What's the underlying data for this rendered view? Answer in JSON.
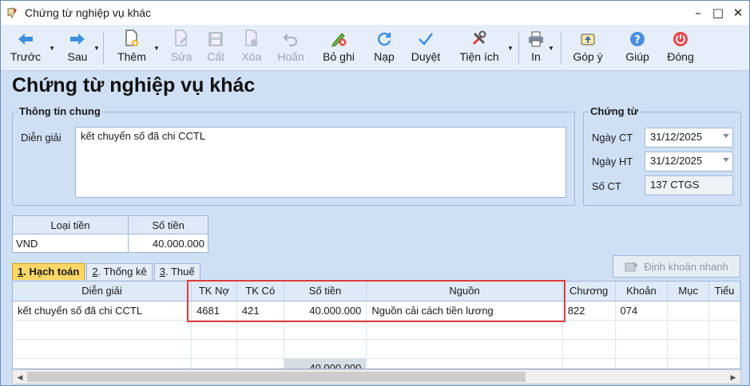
{
  "window": {
    "title": "Chứng từ nghiệp vụ khác",
    "minimize": "–",
    "maximize": "□",
    "close": "✕"
  },
  "toolbar": {
    "items": [
      {
        "label": "Trước",
        "icon": "arrow-left-icon"
      },
      {
        "label": "Sau",
        "icon": "arrow-right-icon"
      },
      {
        "label": "Thêm",
        "icon": "add-document-icon"
      },
      {
        "label": "Sửa",
        "icon": "edit-document-icon"
      },
      {
        "label": "Cất",
        "icon": "save-icon"
      },
      {
        "label": "Xóa",
        "icon": "delete-document-icon"
      },
      {
        "label": "Hoãn",
        "icon": "undo-icon"
      },
      {
        "label": "Bỏ ghi",
        "icon": "unpost-icon"
      },
      {
        "label": "Nạp",
        "icon": "refresh-icon"
      },
      {
        "label": "Duyệt",
        "icon": "checkmark-icon"
      },
      {
        "label": "Tiện ích",
        "icon": "tools-icon"
      },
      {
        "label": "In",
        "icon": "printer-icon"
      },
      {
        "label": "Góp ý",
        "icon": "feedback-icon"
      },
      {
        "label": "Giúp",
        "icon": "help-icon"
      },
      {
        "label": "Đóng",
        "icon": "power-icon"
      }
    ]
  },
  "page_title": "Chứng từ nghiệp vụ khác",
  "general_info": {
    "legend": "Thông tin chung",
    "description_label": "Diễn giải",
    "description_value": "kết chuyển số đã chi CCTL"
  },
  "voucher": {
    "legend": "Chứng từ",
    "date_ct_label": "Ngày CT",
    "date_ct_value": "31/12/2025",
    "date_ht_label": "Ngày HT",
    "date_ht_value": "31/12/2025",
    "number_label": "Số CT",
    "number_value": "137 CTGS"
  },
  "currency_table": {
    "headers": [
      "Loại tiền",
      "Số tiền"
    ],
    "row": {
      "currency": "VND",
      "amount": "40.000.000"
    }
  },
  "tabs": [
    {
      "num": "1",
      "rest": ". Hạch toán"
    },
    {
      "num": "2",
      "rest": ". Thống kê"
    },
    {
      "num": "3",
      "rest": ". Thuế"
    }
  ],
  "quick_entry_button": "Định khoản nhanh",
  "grid": {
    "headers": [
      "Diễn giải",
      "TK Nợ",
      "TK Có",
      "Số tiền",
      "Nguồn",
      "Chương",
      "Khoản",
      "Mục",
      "Tiểu"
    ],
    "rows": [
      [
        "kết chuyển số đã chi CCTL",
        "4681",
        "421",
        "40.000.000",
        "Nguồn cải cách tiền lương",
        "822",
        "074",
        "",
        ""
      ]
    ],
    "total": "40.000.000"
  }
}
